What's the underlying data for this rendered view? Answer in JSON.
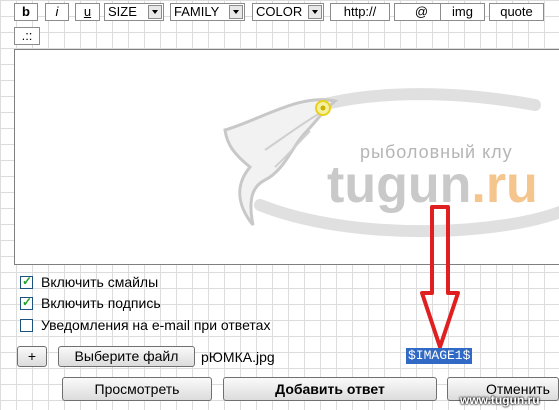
{
  "toolbar": {
    "bold": "b",
    "italic": "i",
    "underline": "u",
    "size": "SIZE",
    "family": "FAMILY",
    "color": "COLOR",
    "http": "http://",
    "email": "@",
    "img": "img",
    "quote": "quote",
    "more": ".::"
  },
  "editor": {
    "watermark_tagline": "рыболовный клу",
    "watermark_brand": "tugun",
    "watermark_domain": ".ru"
  },
  "options": [
    {
      "label": "Включить смайлы",
      "checked": true
    },
    {
      "label": "Включить подпись",
      "checked": true
    },
    {
      "label": "Уведомления на e-mail при ответах",
      "checked": false
    }
  ],
  "attach": {
    "add_label": "+",
    "choose_label": "Выберите файл",
    "file_name": "рЮМКА.jpg",
    "tag": "$IMAGE1$"
  },
  "actions": {
    "preview": "Просмотреть",
    "submit": "Добавить ответ",
    "cancel": "Отменить"
  },
  "site_watermark": "www.tugun.ru",
  "colors": {
    "arrow": "#e02020",
    "highlight": "#316ac5",
    "brand_orange": "#f08a1c"
  }
}
